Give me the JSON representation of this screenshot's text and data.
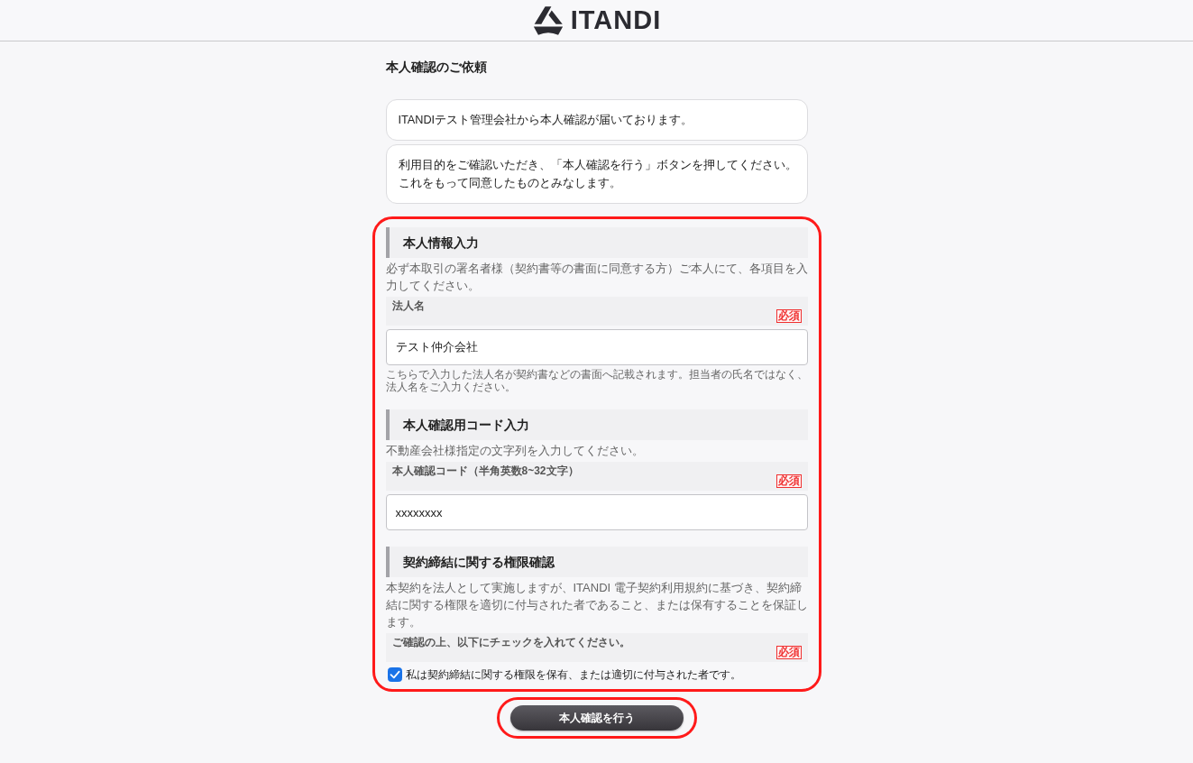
{
  "header": {
    "logo_text": "ITANDI"
  },
  "page_title": "本人確認のご依頼",
  "messages": [
    {
      "lines": [
        "ITANDIテスト管理会社から本人確認が届いております。"
      ]
    },
    {
      "lines": [
        "利用目的をご確認いただき、「本人確認を行う」ボタンを押してください。",
        "これをもって同意したものとみなします。"
      ]
    }
  ],
  "form": {
    "highlighted": true,
    "sections": [
      {
        "heading": "本人情報入力",
        "description": "必ず本取引の署名者様（契約書等の書面に同意する方）ご本人にて、各項目を入力してください。",
        "fields": [
          {
            "kind": "text",
            "label": "法人名",
            "required": true,
            "required_label": "必須",
            "value": "テスト仲介会社",
            "help": "こちらで入力した法人名が契約書などの書面へ記載されます。担当者の氏名ではなく、法人名をご入力ください。"
          }
        ]
      },
      {
        "heading": "本人確認用コード入力",
        "description": "不動産会社様指定の文字列を入力してください。",
        "fields": [
          {
            "kind": "text",
            "label": "本人確認コード（半角英数8~32文字）",
            "required": true,
            "required_label": "必須",
            "value": "xxxxxxxx"
          }
        ]
      },
      {
        "heading": "契約締結に関する権限確認",
        "description": "本契約を法人として実施しますが、ITANDI 電子契約利用規約に基づき、契約締結に関する権限を適切に付与された者であること、または保有することを保証します。",
        "fields": [
          {
            "kind": "checkbox",
            "label": "ご確認の上、以下にチェックを入れてください。",
            "required": true,
            "required_label": "必須",
            "option": "私は契約締結に関する権限を保有、または適切に付与された者です。",
            "checked": true
          }
        ]
      }
    ]
  },
  "submit": {
    "label": "本人確認を行う",
    "highlighted": true
  }
}
